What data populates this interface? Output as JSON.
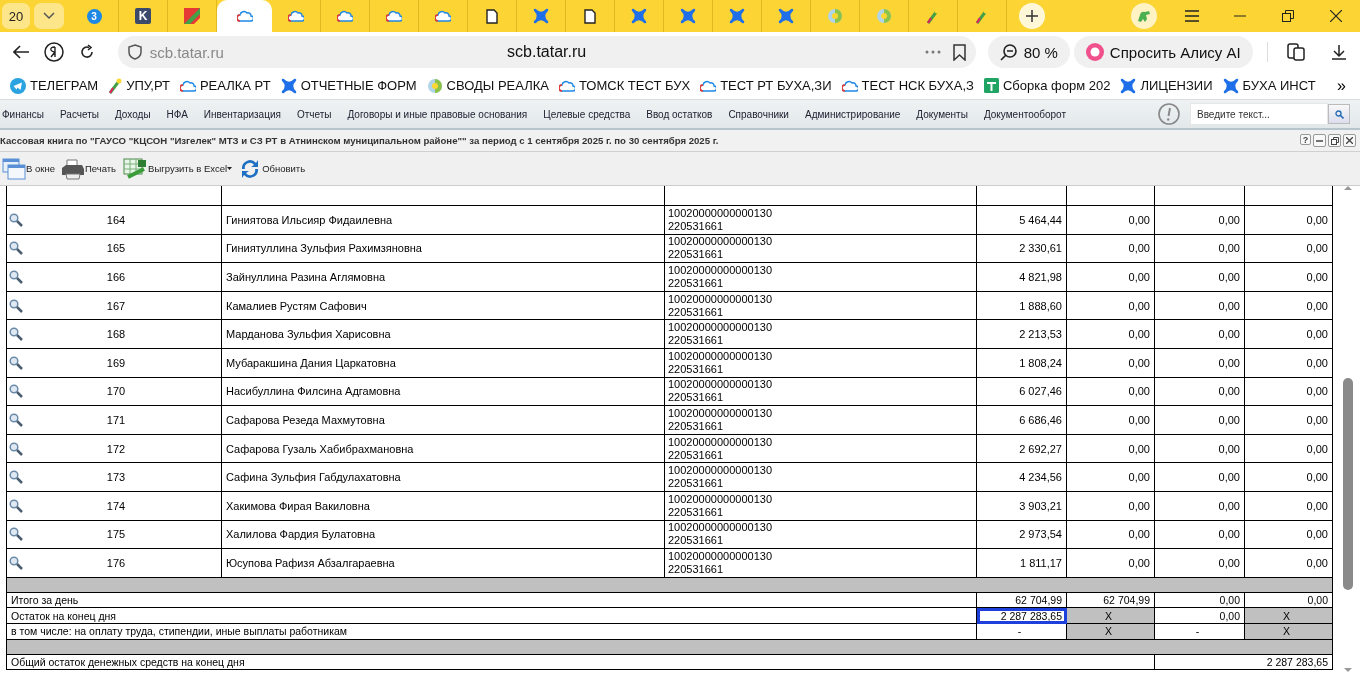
{
  "browser": {
    "tab_count": "20",
    "tabs": [
      {
        "kind": "circle",
        "label": "3",
        "selected": false
      },
      {
        "kind": "k-logo",
        "label": "K",
        "selected": false
      },
      {
        "kind": "multicolor",
        "selected": false
      },
      {
        "kind": "cloud",
        "selected": true
      },
      {
        "kind": "cloud",
        "selected": false
      },
      {
        "kind": "cloud",
        "selected": false
      },
      {
        "kind": "cloud",
        "selected": false
      },
      {
        "kind": "cloud",
        "selected": false
      },
      {
        "kind": "document",
        "selected": false
      },
      {
        "kind": "cross",
        "selected": false
      },
      {
        "kind": "document",
        "selected": false
      },
      {
        "kind": "cross",
        "selected": false
      },
      {
        "kind": "cross",
        "selected": false
      },
      {
        "kind": "cross",
        "selected": false
      },
      {
        "kind": "cross",
        "selected": false
      },
      {
        "kind": "globe",
        "selected": false
      },
      {
        "kind": "globe",
        "selected": false
      },
      {
        "kind": "pen",
        "selected": false
      },
      {
        "kind": "pen",
        "selected": false
      }
    ],
    "address_hint": "scb.tatar.ru",
    "address_title": "scb.tatar.ru",
    "zoom": "80 %",
    "assistant": "Спросить Алису AI",
    "bookmarks": [
      {
        "kind": "telegram",
        "label": "ТЕЛЕГРАМ"
      },
      {
        "kind": "pen",
        "label": "УПУ,РТ"
      },
      {
        "kind": "cloud",
        "label": "РЕАЛКА РТ"
      },
      {
        "kind": "cross",
        "label": "ОТЧЕТНЫЕ ФОРМ"
      },
      {
        "kind": "globe",
        "label": "СВОДЫ РЕАЛКА"
      },
      {
        "kind": "cloud",
        "label": "ТОМСК ТЕСТ БУХ"
      },
      {
        "kind": "cloud",
        "label": "ТЕСТ РТ БУХА,ЗИ"
      },
      {
        "kind": "cloud",
        "label": "ТЕСТ НСК БУХА,З"
      },
      {
        "kind": "sheet",
        "label": "Сборка форм 202"
      },
      {
        "kind": "cross",
        "label": "ЛИЦЕНЗИИ"
      },
      {
        "kind": "cross",
        "label": "БУХА ИНСТ"
      }
    ],
    "more": "»"
  },
  "menu": [
    "Финансы",
    "Расчеты",
    "Доходы",
    "НФА",
    "Инвентаризация",
    "Отчеты",
    "Договоры и иные правовые основания",
    "Целевые средства",
    "Ввод остатков",
    "Справочники",
    "Администрирование",
    "Документы",
    "Документооборот"
  ],
  "search": {
    "placeholder": "Введите текст..."
  },
  "report": {
    "title": "Кассовая книга по \"ГАУСО \"КЦСОН \"Изгелек\" МТЗ и СЗ РТ в Атнинском муниципальном районе\"\" за период с 1 сентября 2025 г. по 30 сентября 2025 г.",
    "help": "?",
    "toolbar": [
      {
        "kind": "window",
        "label": "В окне"
      },
      {
        "kind": "printer",
        "label": "Печать"
      },
      {
        "kind": "excel",
        "label": "Выгрузить в Excel"
      },
      {
        "kind": "refresh",
        "label": "Обновить"
      }
    ]
  },
  "table": {
    "rows": [
      {
        "number": "164",
        "name": "Гиниятова Ильсияр Фидаилевна",
        "account": [
          "10020000000000130",
          "220531661"
        ],
        "values": [
          "5 464,44",
          "0,00",
          "0,00",
          "0,00"
        ]
      },
      {
        "number": "165",
        "name": "Гиниятуллина Зульфия Рахимзяновна",
        "account": [
          "10020000000000130",
          "220531661"
        ],
        "values": [
          "2 330,61",
          "0,00",
          "0,00",
          "0,00"
        ]
      },
      {
        "number": "166",
        "name": "Зайнуллина Разина Аглямовна",
        "account": [
          "10020000000000130",
          "220531661"
        ],
        "values": [
          "4 821,98",
          "0,00",
          "0,00",
          "0,00"
        ]
      },
      {
        "number": "167",
        "name": "Камалиев Рустям Сафович",
        "account": [
          "10020000000000130",
          "220531661"
        ],
        "values": [
          "1 888,60",
          "0,00",
          "0,00",
          "0,00"
        ]
      },
      {
        "number": "168",
        "name": "Марданова Зульфия Харисовна",
        "account": [
          "10020000000000130",
          "220531661"
        ],
        "values": [
          "2 213,53",
          "0,00",
          "0,00",
          "0,00"
        ]
      },
      {
        "number": "169",
        "name": "Мубаракшина Дания Царкатовна",
        "account": [
          "10020000000000130",
          "220531661"
        ],
        "values": [
          "1 808,24",
          "0,00",
          "0,00",
          "0,00"
        ]
      },
      {
        "number": "170",
        "name": "Насибуллина Филсина Адгамовна",
        "account": [
          "10020000000000130",
          "220531661"
        ],
        "values": [
          "6 027,46",
          "0,00",
          "0,00",
          "0,00"
        ]
      },
      {
        "number": "171",
        "name": "Сафарова Резеда Махмутовна",
        "account": [
          "10020000000000130",
          "220531661"
        ],
        "values": [
          "6 686,46",
          "0,00",
          "0,00",
          "0,00"
        ]
      },
      {
        "number": "172",
        "name": "Сафарова Гузаль Хабибрахмановна",
        "account": [
          "10020000000000130",
          "220531661"
        ],
        "values": [
          "2 692,27",
          "0,00",
          "0,00",
          "0,00"
        ]
      },
      {
        "number": "173",
        "name": "Сафина Зульфия Габдулахатовна",
        "account": [
          "10020000000000130",
          "220531661"
        ],
        "values": [
          "4 234,56",
          "0,00",
          "0,00",
          "0,00"
        ]
      },
      {
        "number": "174",
        "name": "Хакимова Фирая Вакиловна",
        "account": [
          "10020000000000130",
          "220531661"
        ],
        "values": [
          "3 903,21",
          "0,00",
          "0,00",
          "0,00"
        ]
      },
      {
        "number": "175",
        "name": "Халилова Фардия Булатовна",
        "account": [
          "10020000000000130",
          "220531661"
        ],
        "values": [
          "2 973,54",
          "0,00",
          "0,00",
          "0,00"
        ]
      },
      {
        "number": "176",
        "name": "Юсупова Рафизя Абзалгараевна",
        "account": [
          "10020000000000130",
          "220531661"
        ],
        "values": [
          "1 811,17",
          "0,00",
          "0,00",
          "0,00"
        ]
      }
    ],
    "summary": [
      {
        "kind": "spacer"
      },
      {
        "kind": "line",
        "label": "Итого за день",
        "cells": [
          {
            "text": "62 704,99",
            "shaded": false,
            "selected": false
          },
          {
            "text": "62 704,99",
            "shaded": false,
            "selected": false
          },
          {
            "text": "0,00",
            "shaded": false,
            "selected": false
          },
          {
            "text": "0,00",
            "shaded": false,
            "selected": false
          }
        ]
      },
      {
        "kind": "line",
        "label": "Остаток на конец дня",
        "cells": [
          {
            "text": "2 287 283,65",
            "shaded": false,
            "selected": true
          },
          {
            "text": "X",
            "shaded": true,
            "selected": false
          },
          {
            "text": "0,00",
            "shaded": false,
            "selected": false
          },
          {
            "text": "X",
            "shaded": true,
            "selected": false
          }
        ]
      },
      {
        "kind": "line",
        "label": "в том числе: на оплату труда, стипендии, иные выплаты работникам",
        "cells": [
          {
            "text": "-",
            "shaded": false,
            "selected": false
          },
          {
            "text": "X",
            "shaded": true,
            "selected": false
          },
          {
            "text": "-",
            "shaded": false,
            "selected": false
          },
          {
            "text": "X",
            "shaded": true,
            "selected": false
          }
        ]
      },
      {
        "kind": "spacer"
      },
      {
        "kind": "grand",
        "label": "Общий остаток денежных средств на конец дня",
        "value": "2 287 283,65"
      }
    ]
  }
}
